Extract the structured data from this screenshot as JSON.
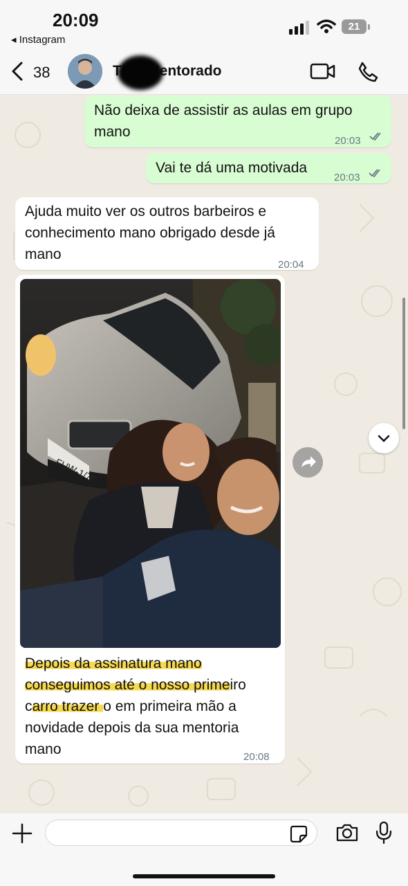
{
  "status_bar": {
    "time": "20:09",
    "back_app": "◂ Instagram",
    "battery": "21"
  },
  "header": {
    "unread_count": "38",
    "contact_name": "Th   o Mentorado"
  },
  "messages": [
    {
      "direction": "out",
      "text": "Não deixa de assistir as aulas em grupo mano",
      "time": "20:03",
      "status": "read"
    },
    {
      "direction": "out",
      "text": "Vai te dá uma motivada",
      "time": "20:03",
      "status": "read"
    },
    {
      "direction": "in",
      "text": "Ajuda muito ver os outros barbeiros e conhecimento mano obrigado desde já mano",
      "time": "20:04"
    },
    {
      "direction": "in",
      "type": "photo",
      "caption_part1": "Depois da assinatura mano",
      "caption_part2": "conseguimos até o nosso prime",
      "caption_part3": "iro",
      "caption_part4": "c",
      "caption_part5": "arro trazer ",
      "caption_part6": "o em primeira mão a",
      "caption_part7": "novidade depois da sua mentoria",
      "caption_part8": "mano",
      "time": "20:08",
      "license_plate": "FUW-1/78"
    }
  ],
  "composer": {
    "placeholder": ""
  },
  "colors": {
    "outgoing": "#d9fdd3",
    "incoming": "#ffffff",
    "highlight": "#f7d94c",
    "background": "#efeae2"
  },
  "icons": [
    "back-chevron-icon",
    "video-call-icon",
    "phone-icon",
    "plus-icon",
    "sticker-icon",
    "camera-icon",
    "microphone-icon",
    "forward-icon",
    "scroll-down-icon",
    "double-check-icon"
  ]
}
